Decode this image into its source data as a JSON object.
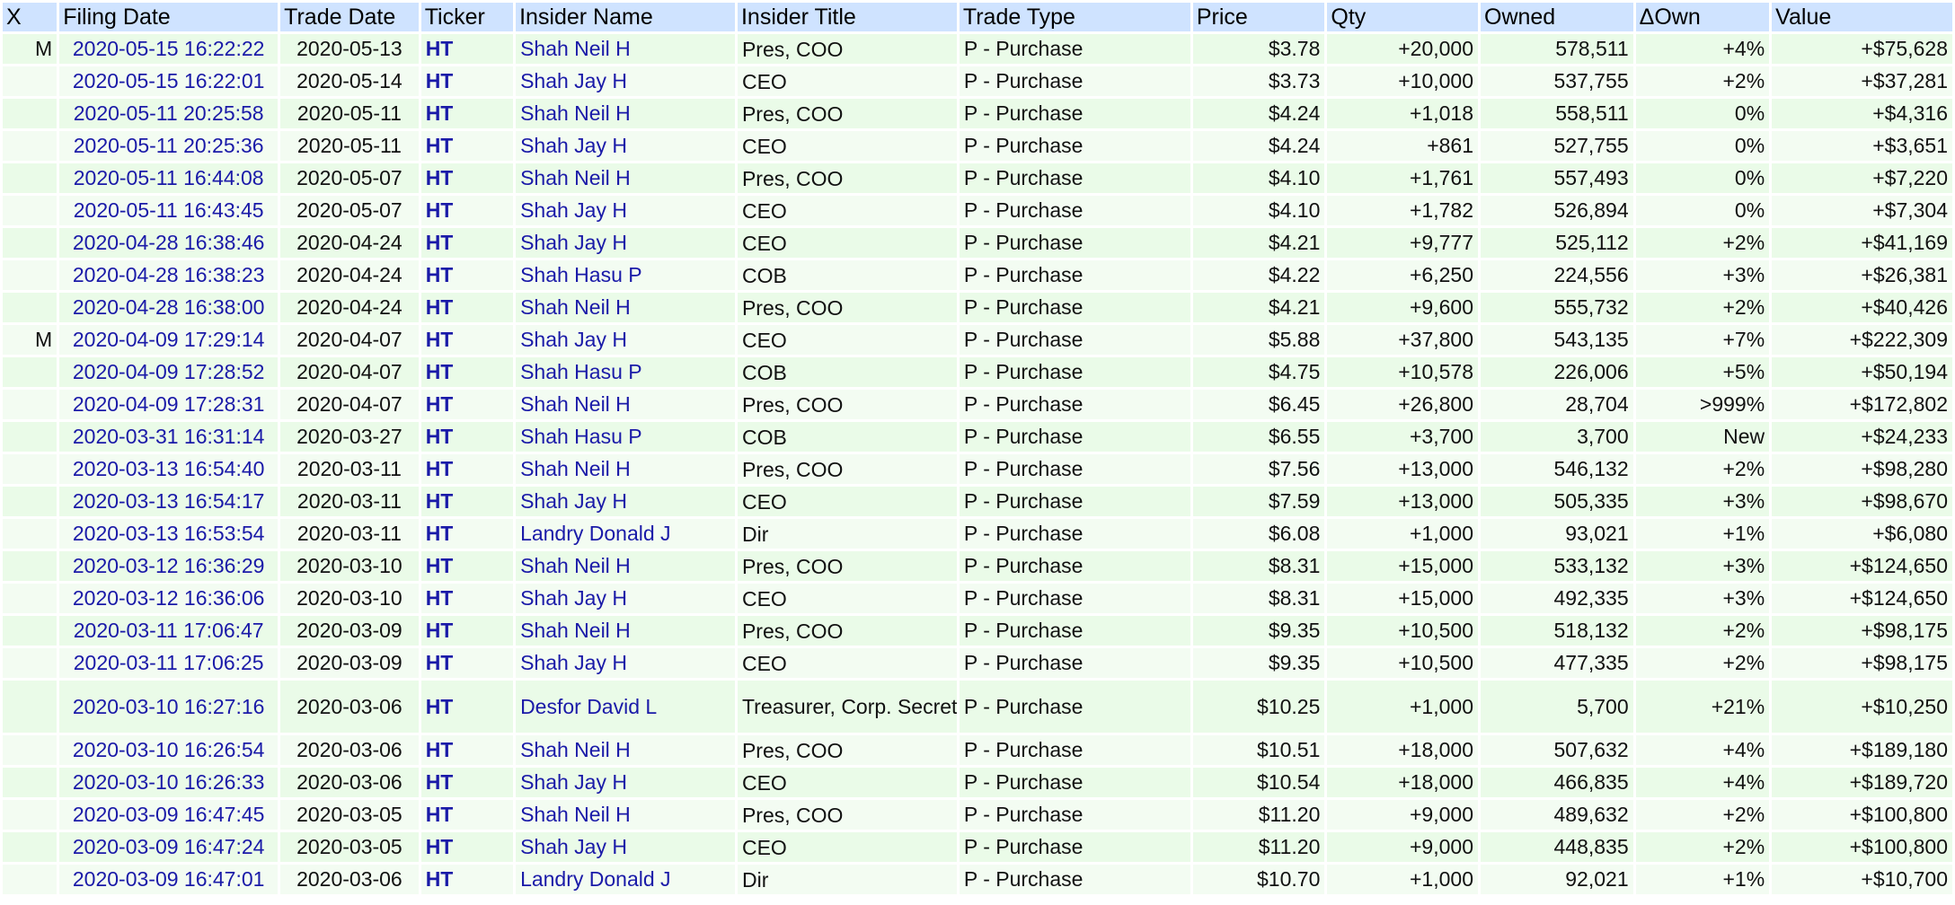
{
  "headers": {
    "x": "X",
    "filing_date": "Filing Date",
    "trade_date": "Trade Date",
    "ticker": "Ticker",
    "insider_name": "Insider Name",
    "insider_title": "Insider Title",
    "trade_type": "Trade Type",
    "price": "Price",
    "qty": "Qty",
    "owned": "Owned",
    "delta_own": "ΔOwn",
    "value": "Value"
  },
  "rows": [
    {
      "x": "M",
      "filing_date": "2020-05-15 16:22:22",
      "trade_date": "2020-05-13",
      "ticker": "HT",
      "insider_name": "Shah Neil H",
      "insider_title": "Pres, COO",
      "trade_type": "P - Purchase",
      "price": "$3.78",
      "qty": "+20,000",
      "owned": "578,511",
      "delta_own": "+4%",
      "value": "+$75,628"
    },
    {
      "x": "",
      "filing_date": "2020-05-15 16:22:01",
      "trade_date": "2020-05-14",
      "ticker": "HT",
      "insider_name": "Shah Jay H",
      "insider_title": "CEO",
      "trade_type": "P - Purchase",
      "price": "$3.73",
      "qty": "+10,000",
      "owned": "537,755",
      "delta_own": "+2%",
      "value": "+$37,281"
    },
    {
      "x": "",
      "filing_date": "2020-05-11 20:25:58",
      "trade_date": "2020-05-11",
      "ticker": "HT",
      "insider_name": "Shah Neil H",
      "insider_title": "Pres, COO",
      "trade_type": "P - Purchase",
      "price": "$4.24",
      "qty": "+1,018",
      "owned": "558,511",
      "delta_own": "0%",
      "value": "+$4,316"
    },
    {
      "x": "",
      "filing_date": "2020-05-11 20:25:36",
      "trade_date": "2020-05-11",
      "ticker": "HT",
      "insider_name": "Shah Jay H",
      "insider_title": "CEO",
      "trade_type": "P - Purchase",
      "price": "$4.24",
      "qty": "+861",
      "owned": "527,755",
      "delta_own": "0%",
      "value": "+$3,651"
    },
    {
      "x": "",
      "filing_date": "2020-05-11 16:44:08",
      "trade_date": "2020-05-07",
      "ticker": "HT",
      "insider_name": "Shah Neil H",
      "insider_title": "Pres, COO",
      "trade_type": "P - Purchase",
      "price": "$4.10",
      "qty": "+1,761",
      "owned": "557,493",
      "delta_own": "0%",
      "value": "+$7,220"
    },
    {
      "x": "",
      "filing_date": "2020-05-11 16:43:45",
      "trade_date": "2020-05-07",
      "ticker": "HT",
      "insider_name": "Shah Jay H",
      "insider_title": "CEO",
      "trade_type": "P - Purchase",
      "price": "$4.10",
      "qty": "+1,782",
      "owned": "526,894",
      "delta_own": "0%",
      "value": "+$7,304"
    },
    {
      "x": "",
      "filing_date": "2020-04-28 16:38:46",
      "trade_date": "2020-04-24",
      "ticker": "HT",
      "insider_name": "Shah Jay H",
      "insider_title": "CEO",
      "trade_type": "P - Purchase",
      "price": "$4.21",
      "qty": "+9,777",
      "owned": "525,112",
      "delta_own": "+2%",
      "value": "+$41,169"
    },
    {
      "x": "",
      "filing_date": "2020-04-28 16:38:23",
      "trade_date": "2020-04-24",
      "ticker": "HT",
      "insider_name": "Shah Hasu P",
      "insider_title": "COB",
      "trade_type": "P - Purchase",
      "price": "$4.22",
      "qty": "+6,250",
      "owned": "224,556",
      "delta_own": "+3%",
      "value": "+$26,381"
    },
    {
      "x": "",
      "filing_date": "2020-04-28 16:38:00",
      "trade_date": "2020-04-24",
      "ticker": "HT",
      "insider_name": "Shah Neil H",
      "insider_title": "Pres, COO",
      "trade_type": "P - Purchase",
      "price": "$4.21",
      "qty": "+9,600",
      "owned": "555,732",
      "delta_own": "+2%",
      "value": "+$40,426"
    },
    {
      "x": "M",
      "filing_date": "2020-04-09 17:29:14",
      "trade_date": "2020-04-07",
      "ticker": "HT",
      "insider_name": "Shah Jay H",
      "insider_title": "CEO",
      "trade_type": "P - Purchase",
      "price": "$5.88",
      "qty": "+37,800",
      "owned": "543,135",
      "delta_own": "+7%",
      "value": "+$222,309"
    },
    {
      "x": "",
      "filing_date": "2020-04-09 17:28:52",
      "trade_date": "2020-04-07",
      "ticker": "HT",
      "insider_name": "Shah Hasu P",
      "insider_title": "COB",
      "trade_type": "P - Purchase",
      "price": "$4.75",
      "qty": "+10,578",
      "owned": "226,006",
      "delta_own": "+5%",
      "value": "+$50,194"
    },
    {
      "x": "",
      "filing_date": "2020-04-09 17:28:31",
      "trade_date": "2020-04-07",
      "ticker": "HT",
      "insider_name": "Shah Neil H",
      "insider_title": "Pres, COO",
      "trade_type": "P - Purchase",
      "price": "$6.45",
      "qty": "+26,800",
      "owned": "28,704",
      "delta_own": ">999%",
      "value": "+$172,802"
    },
    {
      "x": "",
      "filing_date": "2020-03-31 16:31:14",
      "trade_date": "2020-03-27",
      "ticker": "HT",
      "insider_name": "Shah Hasu P",
      "insider_title": "COB",
      "trade_type": "P - Purchase",
      "price": "$6.55",
      "qty": "+3,700",
      "owned": "3,700",
      "delta_own": "New",
      "value": "+$24,233"
    },
    {
      "x": "",
      "filing_date": "2020-03-13 16:54:40",
      "trade_date": "2020-03-11",
      "ticker": "HT",
      "insider_name": "Shah Neil H",
      "insider_title": "Pres, COO",
      "trade_type": "P - Purchase",
      "price": "$7.56",
      "qty": "+13,000",
      "owned": "546,132",
      "delta_own": "+2%",
      "value": "+$98,280"
    },
    {
      "x": "",
      "filing_date": "2020-03-13 16:54:17",
      "trade_date": "2020-03-11",
      "ticker": "HT",
      "insider_name": "Shah Jay H",
      "insider_title": "CEO",
      "trade_type": "P - Purchase",
      "price": "$7.59",
      "qty": "+13,000",
      "owned": "505,335",
      "delta_own": "+3%",
      "value": "+$98,670"
    },
    {
      "x": "",
      "filing_date": "2020-03-13 16:53:54",
      "trade_date": "2020-03-11",
      "ticker": "HT",
      "insider_name": "Landry Donald J",
      "insider_title": "Dir",
      "trade_type": "P - Purchase",
      "price": "$6.08",
      "qty": "+1,000",
      "owned": "93,021",
      "delta_own": "+1%",
      "value": "+$6,080"
    },
    {
      "x": "",
      "filing_date": "2020-03-12 16:36:29",
      "trade_date": "2020-03-10",
      "ticker": "HT",
      "insider_name": "Shah Neil H",
      "insider_title": "Pres, COO",
      "trade_type": "P - Purchase",
      "price": "$8.31",
      "qty": "+15,000",
      "owned": "533,132",
      "delta_own": "+3%",
      "value": "+$124,650"
    },
    {
      "x": "",
      "filing_date": "2020-03-12 16:36:06",
      "trade_date": "2020-03-10",
      "ticker": "HT",
      "insider_name": "Shah Jay H",
      "insider_title": "CEO",
      "trade_type": "P - Purchase",
      "price": "$8.31",
      "qty": "+15,000",
      "owned": "492,335",
      "delta_own": "+3%",
      "value": "+$124,650"
    },
    {
      "x": "",
      "filing_date": "2020-03-11 17:06:47",
      "trade_date": "2020-03-09",
      "ticker": "HT",
      "insider_name": "Shah Neil H",
      "insider_title": "Pres, COO",
      "trade_type": "P - Purchase",
      "price": "$9.35",
      "qty": "+10,500",
      "owned": "518,132",
      "delta_own": "+2%",
      "value": "+$98,175"
    },
    {
      "x": "",
      "filing_date": "2020-03-11 17:06:25",
      "trade_date": "2020-03-09",
      "ticker": "HT",
      "insider_name": "Shah Jay H",
      "insider_title": "CEO",
      "trade_type": "P - Purchase",
      "price": "$9.35",
      "qty": "+10,500",
      "owned": "477,335",
      "delta_own": "+2%",
      "value": "+$98,175"
    },
    {
      "x": "",
      "filing_date": "2020-03-10 16:27:16",
      "trade_date": "2020-03-06",
      "ticker": "HT",
      "insider_name": "Desfor David L",
      "insider_title": "Treasurer, Corp. Secretary",
      "trade_type": "P - Purchase",
      "price": "$10.25",
      "qty": "+1,000",
      "owned": "5,700",
      "delta_own": "+21%",
      "value": "+$10,250"
    },
    {
      "x": "",
      "filing_date": "2020-03-10 16:26:54",
      "trade_date": "2020-03-06",
      "ticker": "HT",
      "insider_name": "Shah Neil H",
      "insider_title": "Pres, COO",
      "trade_type": "P - Purchase",
      "price": "$10.51",
      "qty": "+18,000",
      "owned": "507,632",
      "delta_own": "+4%",
      "value": "+$189,180"
    },
    {
      "x": "",
      "filing_date": "2020-03-10 16:26:33",
      "trade_date": "2020-03-06",
      "ticker": "HT",
      "insider_name": "Shah Jay H",
      "insider_title": "CEO",
      "trade_type": "P - Purchase",
      "price": "$10.54",
      "qty": "+18,000",
      "owned": "466,835",
      "delta_own": "+4%",
      "value": "+$189,720"
    },
    {
      "x": "",
      "filing_date": "2020-03-09 16:47:45",
      "trade_date": "2020-03-05",
      "ticker": "HT",
      "insider_name": "Shah Neil H",
      "insider_title": "Pres, COO",
      "trade_type": "P - Purchase",
      "price": "$11.20",
      "qty": "+9,000",
      "owned": "489,632",
      "delta_own": "+2%",
      "value": "+$100,800"
    },
    {
      "x": "",
      "filing_date": "2020-03-09 16:47:24",
      "trade_date": "2020-03-05",
      "ticker": "HT",
      "insider_name": "Shah Jay H",
      "insider_title": "CEO",
      "trade_type": "P - Purchase",
      "price": "$11.20",
      "qty": "+9,000",
      "owned": "448,835",
      "delta_own": "+2%",
      "value": "+$100,800"
    },
    {
      "x": "",
      "filing_date": "2020-03-09 16:47:01",
      "trade_date": "2020-03-06",
      "ticker": "HT",
      "insider_name": "Landry Donald J",
      "insider_title": "Dir",
      "trade_type": "P - Purchase",
      "price": "$10.70",
      "qty": "+1,000",
      "owned": "92,021",
      "delta_own": "+1%",
      "value": "+$10,700"
    }
  ]
}
